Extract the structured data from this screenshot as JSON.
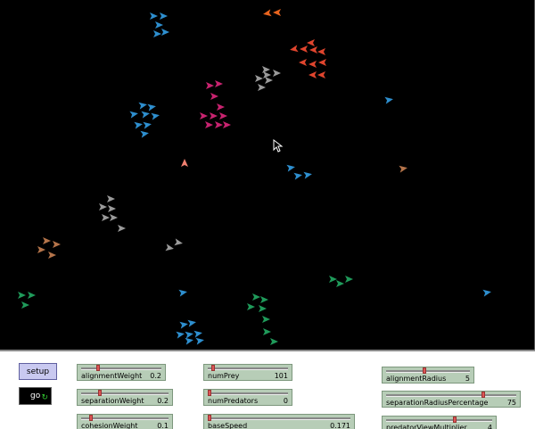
{
  "buttons": {
    "setup_label": "setup",
    "go_label": "go",
    "go_loop_icon": "forever-loop-icon"
  },
  "sliders": [
    {
      "name": "alignmentWeight",
      "value": "0.2",
      "fraction": 0.2
    },
    {
      "name": "separationWeight",
      "value": "0.2",
      "fraction": 0.2
    },
    {
      "name": "cohesionWeight",
      "value": "0.1",
      "fraction": 0.1
    },
    {
      "name": "numPrey",
      "value": "101",
      "fraction": 0.05
    },
    {
      "name": "numPredators",
      "value": "0",
      "fraction": 0.0
    },
    {
      "name": "baseSpeed",
      "value": "0.171",
      "fraction": 0.0
    },
    {
      "name": "alignmentRadius",
      "value": "5",
      "fraction": 0.45
    },
    {
      "name": "separationRadiusPercentage",
      "value": "75",
      "fraction": 0.75
    },
    {
      "name": "predatorViewMultiplier",
      "value": "4",
      "fraction": 0.65
    }
  ],
  "colors": {
    "world_background": "#000000",
    "slider_background": "#b7cdb7",
    "button_background": "#c9c9f0",
    "blue": "#2e8fcf",
    "red": "#e0452e",
    "magenta": "#c8236f",
    "gray": "#9a9a9a",
    "brown": "#b5744a",
    "green": "#1f9a5a",
    "orange": "#e8641e",
    "salmon": "#f08070"
  }
}
